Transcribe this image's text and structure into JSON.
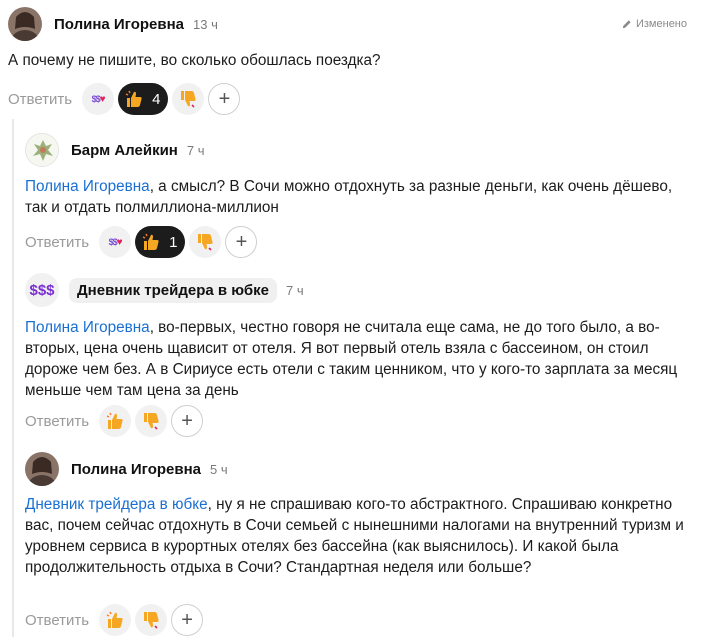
{
  "comments": [
    {
      "author": "Полина Игоревна",
      "time": "13 ч",
      "edited": "Изменено",
      "text": "А почему не пишите, во сколько обошлась поездка?",
      "reply": "Ответить",
      "money_label": "$$",
      "like_count": "4"
    },
    {
      "author": "Барм Алейкин",
      "time": "7 ч",
      "mention": "Полина Игоревна",
      "text": ", а смысл? В Сочи можно отдохнуть за разные деньги, как очень дёшево, так и отдать полмиллиона-миллион",
      "reply": "Ответить",
      "money_label": "$$",
      "like_count": "1"
    },
    {
      "author": "Дневник трейдера в юбке",
      "time": "7 ч",
      "avatar_text": "$$$",
      "mention": "Полина Игоревна",
      "text": ", во-первых, честно говоря не считала еще сама, не до того было, а во-вторых, цена очень щависит от отеля. Я вот первый отель взяла с бассеином, он стоил дороже чем без. А в Сириусе есть отели с таким ценником, что у кого-то зарплата за месяц меньше чем там цена за день",
      "reply": "Ответить"
    },
    {
      "author": "Полина Игоревна",
      "time": "5 ч",
      "mention": "Дневник трейдера в юбке",
      "text": ", ну я не спрашиваю кого-то абстрактного. Спрашиваю конкретно вас, почем сейчас отдохнуть в Сочи семьей с нынешними налогами на внутренний туризм и уровнем сервиса в курортных отелях без бассейна (как выяснилось). И какой была продолжительность отдыха в Сочи? Стандартная неделя или больше?",
      "reply": "Ответить"
    }
  ],
  "icons": {
    "like": "thumbs-up-icon",
    "dislike": "thumbs-down-icon",
    "add": "plus-icon",
    "edit": "pencil-icon",
    "money": "money-heart-icon"
  },
  "colors": {
    "mention": "#1a6fd1",
    "pill_dark": "#1c1c1c",
    "thumb_yellow": "#f5a623"
  }
}
